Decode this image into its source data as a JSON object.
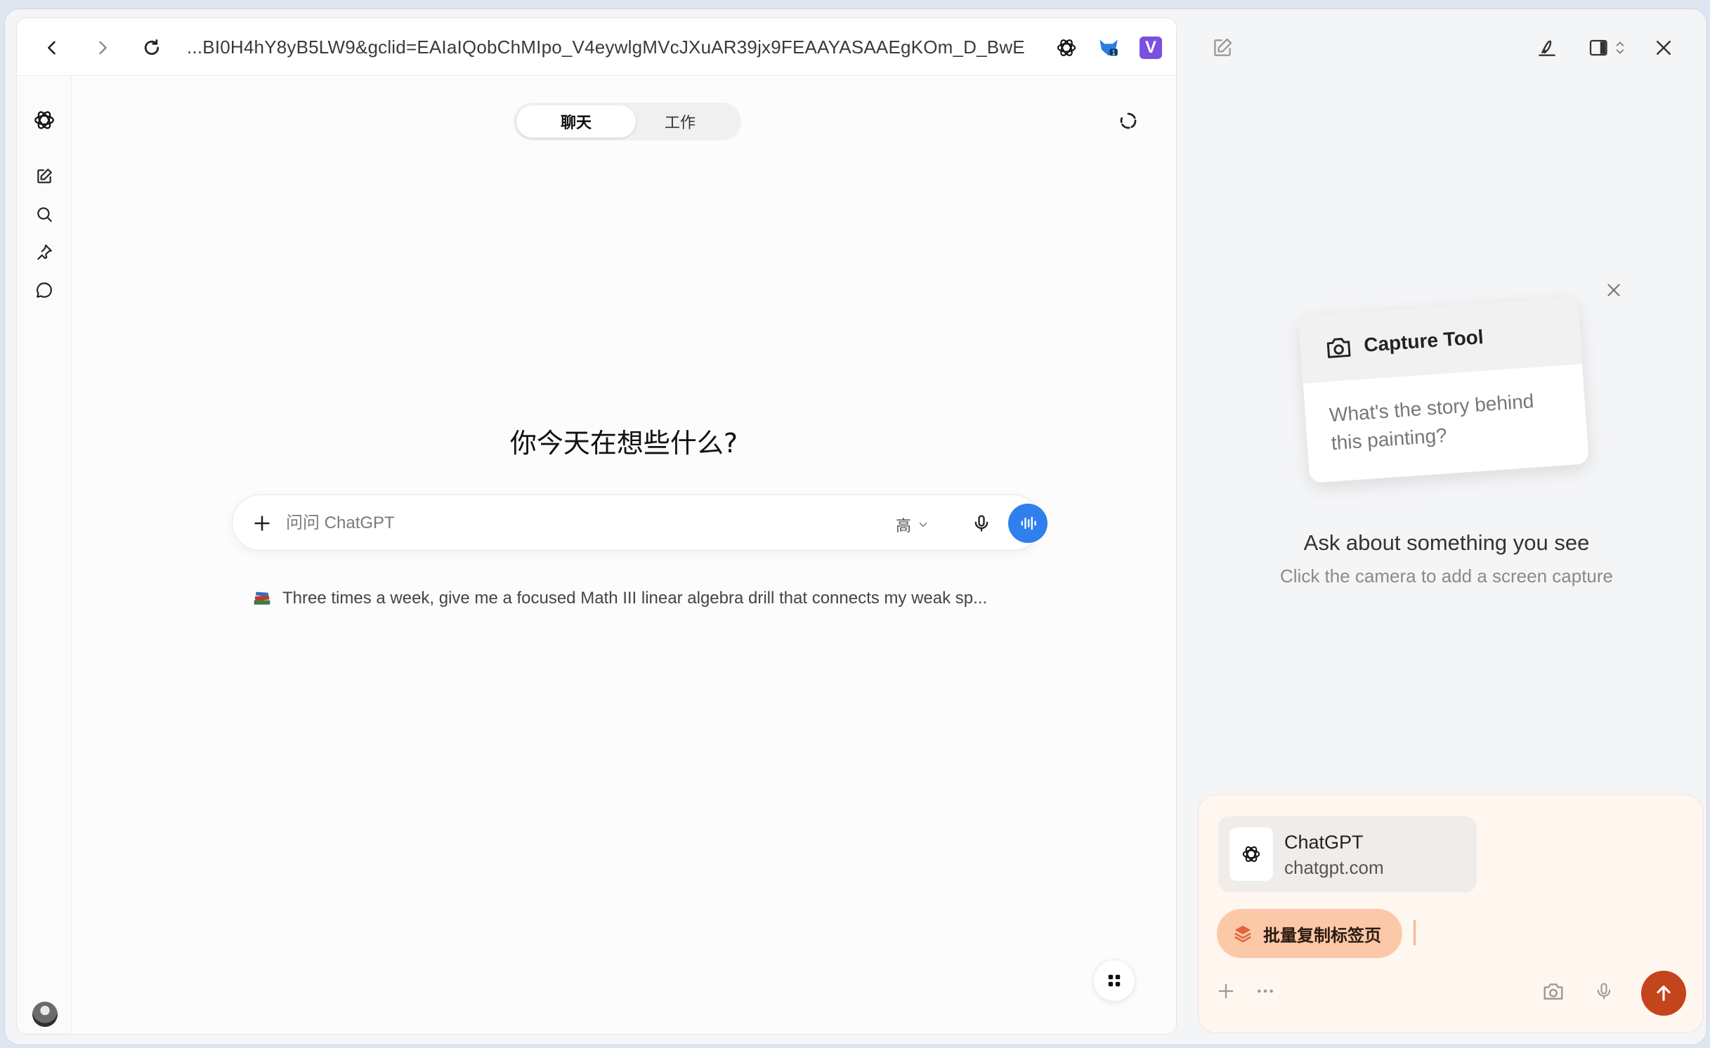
{
  "browser": {
    "url": "...BI0H4hY8yB5LW9&gclid=EAIaIQobChMIpo_V4eywlgMVcJXuAR39jx9FEAAYASAAEgKOm_D_BwE",
    "ext_v_label": "V"
  },
  "chat": {
    "modes": {
      "chat": "聊天",
      "work": "工作"
    },
    "headline": "你今天在想些什么?",
    "composer": {
      "placeholder": "问问 ChatGPT",
      "quality": "高"
    },
    "suggestion": "Three times a week, give me a focused Math III linear algebra drill that connects my weak sp..."
  },
  "side_panel": {
    "capture_card": {
      "title": "Capture Tool",
      "prompt": "What's the story behind this painting?"
    },
    "ask_title": "Ask about something you see",
    "ask_subtitle": "Click the camera to add a screen capture",
    "context": {
      "site_name": "ChatGPT",
      "site_url": "chatgpt.com"
    },
    "chip_label": "批量复制标签页"
  },
  "colors": {
    "voice_button": "#2f80ed",
    "send_button": "#c4441c",
    "chip_bg": "#fcc9a8",
    "ext_v": "#7b4fe0"
  }
}
